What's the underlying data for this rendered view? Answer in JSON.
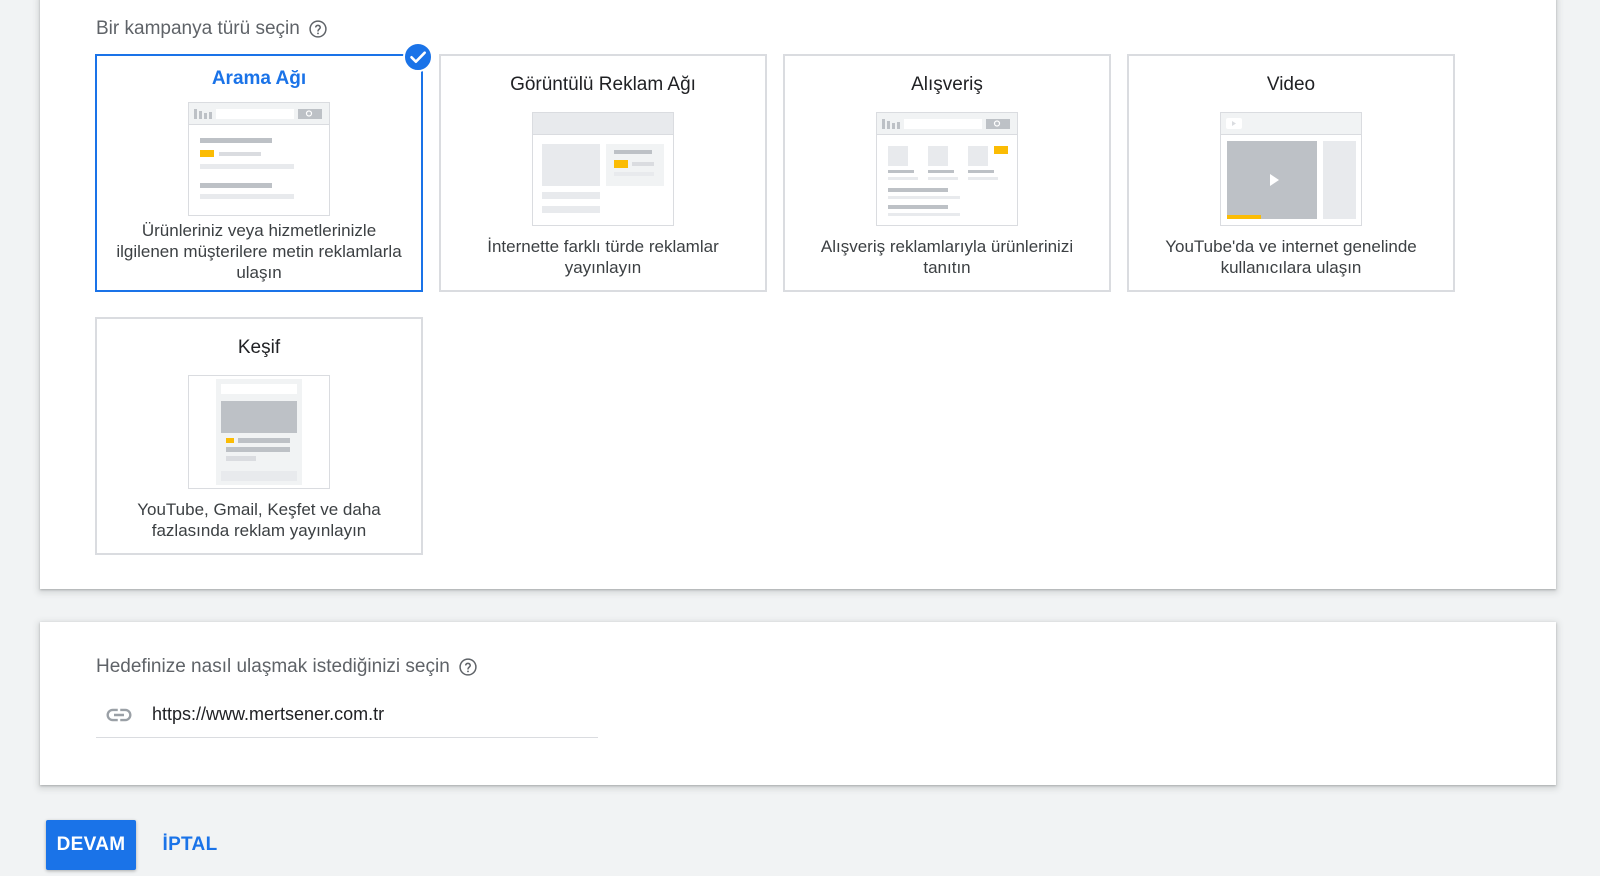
{
  "campaign_type": {
    "label": "Bir kampanya türü seçin",
    "help_icon": "help-circle-icon",
    "cards": [
      {
        "title": "Arama Ağı",
        "description": "Ürünleriniz veya hizmetlerinizle ilgilenen müşterilere metin reklamlarla ulaşın",
        "selected": true,
        "illustration": "search-network-illustration"
      },
      {
        "title": "Görüntülü Reklam Ağı",
        "description": "İnternette farklı türde reklamlar yayınlayın",
        "selected": false,
        "illustration": "display-network-illustration"
      },
      {
        "title": "Alışveriş",
        "description": "Alışveriş reklamlarıyla ürünlerinizi tanıtın",
        "selected": false,
        "illustration": "shopping-illustration"
      },
      {
        "title": "Video",
        "description": "YouTube'da ve internet genelinde kullanıcılara ulaşın",
        "selected": false,
        "illustration": "video-illustration"
      },
      {
        "title": "Keşif",
        "description": "YouTube, Gmail, Keşfet ve daha fazlasında reklam yayınlayın",
        "selected": false,
        "illustration": "discovery-illustration"
      }
    ],
    "check_icon": "check-circle-icon"
  },
  "goal": {
    "label": "Hedefinize nasıl ulaşmak istediğinizi seçin",
    "help_icon": "help-circle-icon",
    "url_value": "https://www.mertsener.com.tr",
    "link_icon": "link-icon"
  },
  "actions": {
    "continue_label": "DEVAM",
    "cancel_label": "İPTAL"
  },
  "colors": {
    "accent": "#1a73e8",
    "highlight": "#fbbc04",
    "background": "#f1f3f4"
  }
}
